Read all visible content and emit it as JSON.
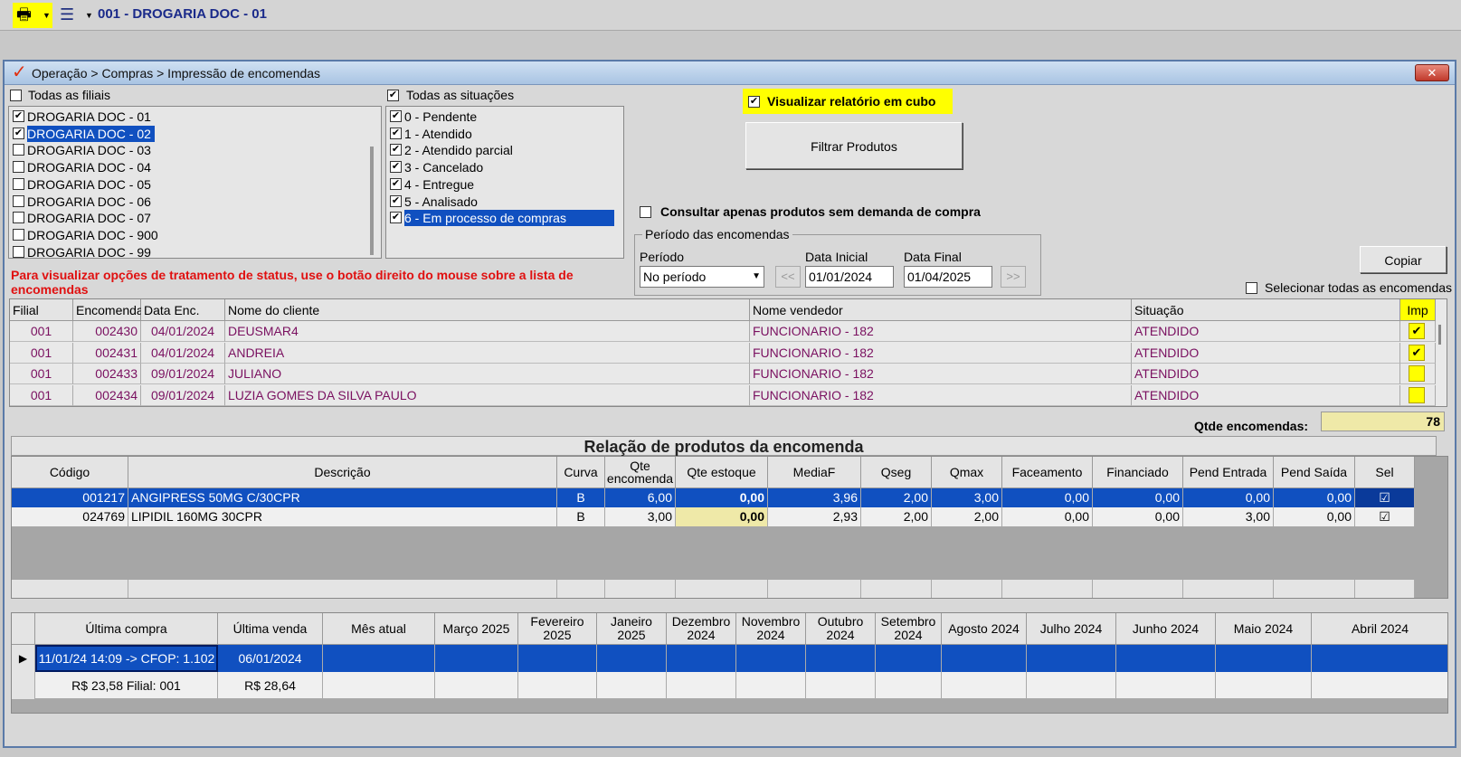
{
  "topbar": {
    "title": "001 - DROGARIA DOC - 01"
  },
  "window": {
    "breadcrumb": "Operação > Compras > Impressão de encomendas",
    "close": "✕"
  },
  "filiais": {
    "all_label": "Todas as filiais",
    "items": [
      {
        "label": "DROGARIA DOC - 01",
        "checked": true
      },
      {
        "label": "DROGARIA DOC - 02",
        "checked": true
      },
      {
        "label": "DROGARIA DOC - 03",
        "checked": false
      },
      {
        "label": "DROGARIA DOC - 04",
        "checked": false
      },
      {
        "label": "DROGARIA DOC - 05",
        "checked": false
      },
      {
        "label": "DROGARIA DOC - 06",
        "checked": false
      },
      {
        "label": "DROGARIA DOC - 07",
        "checked": false
      },
      {
        "label": "DROGARIA DOC - 900",
        "checked": false
      },
      {
        "label": "DROGARIA DOC - 99",
        "checked": false
      }
    ]
  },
  "situacoes": {
    "all_label": "Todas as situações",
    "items": [
      {
        "label": "0 - Pendente",
        "checked": true
      },
      {
        "label": "1 - Atendido",
        "checked": true
      },
      {
        "label": "2 - Atendido parcial",
        "checked": true
      },
      {
        "label": "3 - Cancelado",
        "checked": true
      },
      {
        "label": "4 - Entregue",
        "checked": true
      },
      {
        "label": "5 - Analisado",
        "checked": true
      },
      {
        "label": "6 - Em processo de compras",
        "checked": true
      }
    ]
  },
  "options": {
    "cubo_label": "Visualizar relatório em cubo",
    "filtrar_label": "Filtrar Produtos",
    "sem_demanda_label": "Consultar apenas produtos sem demanda de compra",
    "copiar_label": "Copiar",
    "selecionar_todas_label": "Selecionar todas as encomendas"
  },
  "periodo": {
    "group_label": "Período das encomendas",
    "periodo_label": "Período",
    "periodo_value": "No período",
    "data_inicial_label": "Data Inicial",
    "data_inicial": "01/01/2024",
    "data_final_label": "Data Final",
    "data_final": "01/04/2025",
    "prev": "<<",
    "next": ">>"
  },
  "note": "Para visualizar opções de tratamento de status, use o botão direito do mouse sobre a lista de encomendas",
  "orders": {
    "headers": [
      "Filial",
      "Encomenda",
      "Data Enc.",
      "Nome do cliente",
      "Nome vendedor",
      "Situação",
      "Imp"
    ],
    "rows": [
      [
        "001",
        "002430",
        "04/01/2024",
        "DEUSMAR4",
        "FUNCIONARIO - 182",
        "ATENDIDO"
      ],
      [
        "001",
        "002431",
        "04/01/2024",
        "ANDREIA",
        "FUNCIONARIO - 182",
        "ATENDIDO"
      ],
      [
        "001",
        "002433",
        "09/01/2024",
        "JULIANO",
        "FUNCIONARIO - 182",
        "ATENDIDO"
      ],
      [
        "001",
        "002434",
        "09/01/2024",
        "LUZIA GOMES DA SILVA PAULO",
        "FUNCIONARIO - 182",
        "ATENDIDO"
      ]
    ],
    "imp_marks": [
      "✔",
      "✔",
      "",
      ""
    ],
    "qtde_label": "Qtde encomendas:",
    "qtde_value": "78"
  },
  "products": {
    "title": "Relação de produtos da encomenda",
    "headers": [
      "Código",
      "Descrição",
      "Curva",
      "Qte encomenda",
      "Qte estoque",
      "MediaF",
      "Qseg",
      "Qmax",
      "Faceamento",
      "Financiado",
      "Pend Entrada",
      "Pend Saída",
      "Sel"
    ],
    "rows": [
      [
        "001217",
        "ANGIPRESS 50MG C/30CPR",
        "B",
        "6,00",
        "0,00",
        "3,96",
        "2,00",
        "3,00",
        "0,00",
        "0,00",
        "0,00",
        "0,00",
        "☑"
      ],
      [
        "024769",
        "LIPIDIL 160MG 30CPR",
        "B",
        "3,00",
        "0,00",
        "2,93",
        "2,00",
        "2,00",
        "0,00",
        "0,00",
        "3,00",
        "0,00",
        "☑"
      ]
    ]
  },
  "history": {
    "headers": [
      "Última compra",
      "Última venda",
      "Mês atual",
      "Março 2025",
      "Fevereiro 2025",
      "Janeiro 2025",
      "Dezembro 2024",
      "Novembro 2024",
      "Outubro 2024",
      "Setembro 2024",
      "Agosto 2024",
      "Julho 2024",
      "Junho 2024",
      "Maio 2024",
      "Abril 2024"
    ],
    "row1": [
      "11/01/24 14:09 -> CFOP: 1.102",
      "06/01/2024"
    ],
    "row2": [
      "R$ 23,58 Filial: 001",
      "R$ 28,64"
    ]
  },
  "colors": {
    "selection": "#1050c0",
    "highlight": "#ffff00",
    "note": "#e01010",
    "order_text": "#7a1060"
  }
}
